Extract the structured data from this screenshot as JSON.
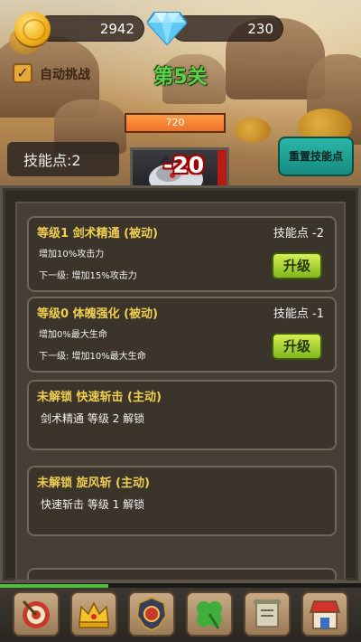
{
  "header": {
    "gold": "2942",
    "diamonds": "230",
    "auto_challenge_label": "自动挑战",
    "auto_challenge_checked": true,
    "level_title": "第5关"
  },
  "battle": {
    "enemy_hp": "720",
    "damage": "-20"
  },
  "skills_header": {
    "skill_points": "技能点:2",
    "reset_label": "重置技能点"
  },
  "skills": [
    {
      "title": "等级1 剑术精通 (被动)",
      "cost": "技能点 -2",
      "current": "增加10%攻击力",
      "next": "下一级: 增加15%攻击力",
      "button": "升级"
    },
    {
      "title": "等级0 体魄强化 (被动)",
      "cost": "技能点 -1",
      "current": "增加0%最大生命",
      "next": "下一级: 增加10%最大生命",
      "button": "升级"
    },
    {
      "title": "未解锁 快速斩击 (主动)",
      "requirement": "剑术精通 等级 2 解锁"
    },
    {
      "title": "未解锁 旋风斩 (主动)",
      "requirement": "快速斩击 等级 1 解锁"
    }
  ],
  "bottom_nav": [
    "target-icon",
    "crown-icon",
    "compass-shield-icon",
    "clover-icon",
    "scroll-icon",
    "shop-icon"
  ],
  "colors": {
    "level_title": "#5ed04a",
    "skill_title": "#f0cf50",
    "upgrade_button": "#a7d434",
    "reset_button": "#1f9f93"
  }
}
